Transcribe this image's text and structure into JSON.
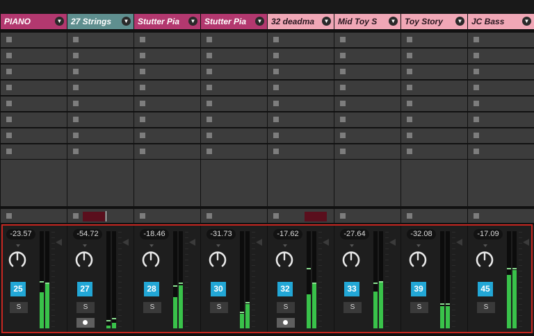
{
  "tracks": [
    {
      "name": "PIANO",
      "color": "#b3386f",
      "light": false,
      "volume": "-23.57",
      "channel": "25",
      "solo": "S",
      "meter": [
        0.37,
        0.46
      ],
      "peak": [
        0.47,
        0.46
      ],
      "monitor": false,
      "send_level": null
    },
    {
      "name": "27 Strings",
      "color": "#5f8f8f",
      "light": false,
      "volume": "-54.72",
      "channel": "27",
      "solo": "S",
      "meter": [
        0.03,
        0.06
      ],
      "peak": [
        0.07,
        0.09
      ],
      "monitor": true,
      "send_level": 0.3
    },
    {
      "name": "Stutter Pia",
      "color": "#b3386f",
      "light": false,
      "volume": "-18.46",
      "channel": "28",
      "solo": "S",
      "meter": [
        0.32,
        0.44
      ],
      "peak": [
        0.43,
        0.46
      ],
      "monitor": false,
      "send_level": null
    },
    {
      "name": "Stutter Pia",
      "color": "#b3386f",
      "light": false,
      "volume": "-31.73",
      "channel": "30",
      "solo": "S",
      "meter": [
        0.15,
        0.25
      ],
      "peak": [
        0.16,
        0.26
      ],
      "monitor": false,
      "send_level": null
    },
    {
      "name": "32 deadma",
      "color": "#f0a7b6",
      "light": true,
      "volume": "-17.62",
      "channel": "32",
      "solo": "S",
      "meter": [
        0.35,
        0.46
      ],
      "peak": [
        0.61,
        0.46
      ],
      "monitor": true,
      "send_level": 0.4
    },
    {
      "name": "Mid Toy S",
      "color": "#f0a7b6",
      "light": true,
      "volume": "-27.64",
      "channel": "33",
      "solo": "S",
      "meter": [
        0.38,
        0.47
      ],
      "peak": [
        0.46,
        0.47
      ],
      "monitor": false,
      "send_level": null
    },
    {
      "name": "Toy Story",
      "color": "#f0a7b6",
      "light": true,
      "volume": "-32.08",
      "channel": "39",
      "solo": "S",
      "meter": [
        0.23,
        0.23
      ],
      "peak": [
        0.24,
        0.24
      ],
      "monitor": false,
      "send_level": null
    },
    {
      "name": "JC Bass",
      "color": "#f0a7b6",
      "light": true,
      "volume": "-17.09",
      "channel": "45",
      "solo": "S",
      "meter": [
        0.55,
        0.6
      ],
      "peak": [
        0.61,
        0.61
      ],
      "monitor": false,
      "send_level": null
    }
  ],
  "icons": {
    "dropdown": "chevron-down-icon",
    "pan_knob": "pan-knob-icon",
    "monitor": "monitor-icon"
  },
  "colors": {
    "highlight": "#c52620",
    "channel_number_bg": "#22a7d6",
    "meter_green": "#39c24a"
  }
}
